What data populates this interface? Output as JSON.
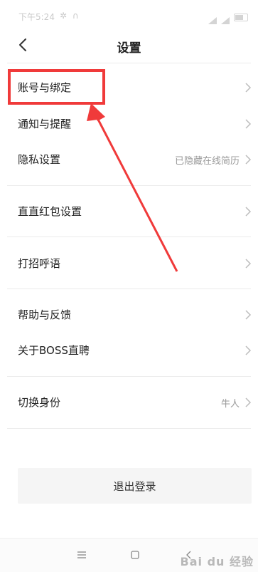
{
  "status_bar": {
    "time": "下午5:24",
    "notifications": "✲ ∩"
  },
  "header": {
    "title": "设置"
  },
  "groups": [
    {
      "items": [
        {
          "label": "账号与绑定",
          "value": ""
        },
        {
          "label": "通知与提醒",
          "value": ""
        },
        {
          "label": "隐私设置",
          "value": "已隐藏在线简历"
        }
      ]
    },
    {
      "items": [
        {
          "label": "直直红包设置",
          "value": ""
        }
      ]
    },
    {
      "items": [
        {
          "label": "打招呼语",
          "value": ""
        }
      ]
    },
    {
      "items": [
        {
          "label": "帮助与反馈",
          "value": ""
        },
        {
          "label": "关于BOSS直聘",
          "value": ""
        }
      ]
    },
    {
      "items": [
        {
          "label": "切换身份",
          "value": "牛人"
        }
      ]
    }
  ],
  "logout": {
    "label": "退出登录"
  },
  "watermark": "Bai du 经验",
  "colors": {
    "annotation": "#f03a3a",
    "divider": "#ececec",
    "muted": "#9a9a9a"
  },
  "icons": [
    "back-arrow-icon",
    "chevron-right-icon",
    "menu-icon",
    "home-icon",
    "back-nav-icon"
  ]
}
